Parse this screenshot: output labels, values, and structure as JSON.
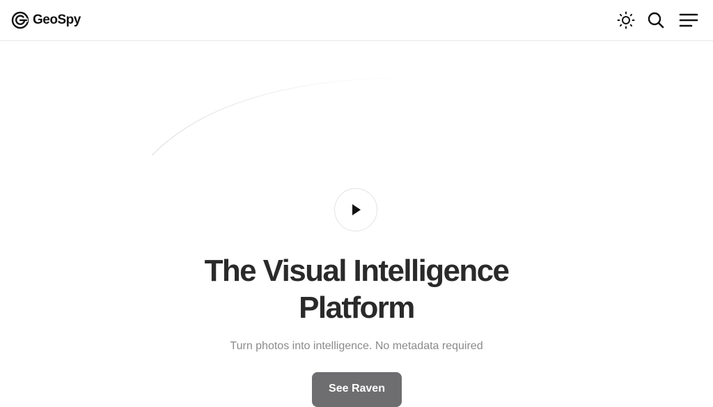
{
  "header": {
    "logo_text": "GeoSpy",
    "icons": [
      "logo-icon",
      "sun-icon",
      "search-icon",
      "menu-icon"
    ]
  },
  "hero": {
    "title": "The Visual Intelligence Platform",
    "subtitle": "Turn photos into intelligence. No metadata required",
    "cta_label": "See Raven",
    "play_icon": "play-icon"
  },
  "colors": {
    "text_primary": "#2a2a2a",
    "text_muted": "#8a8a8a",
    "cta_background": "#6e6e70",
    "border": "#e6e6e6"
  }
}
